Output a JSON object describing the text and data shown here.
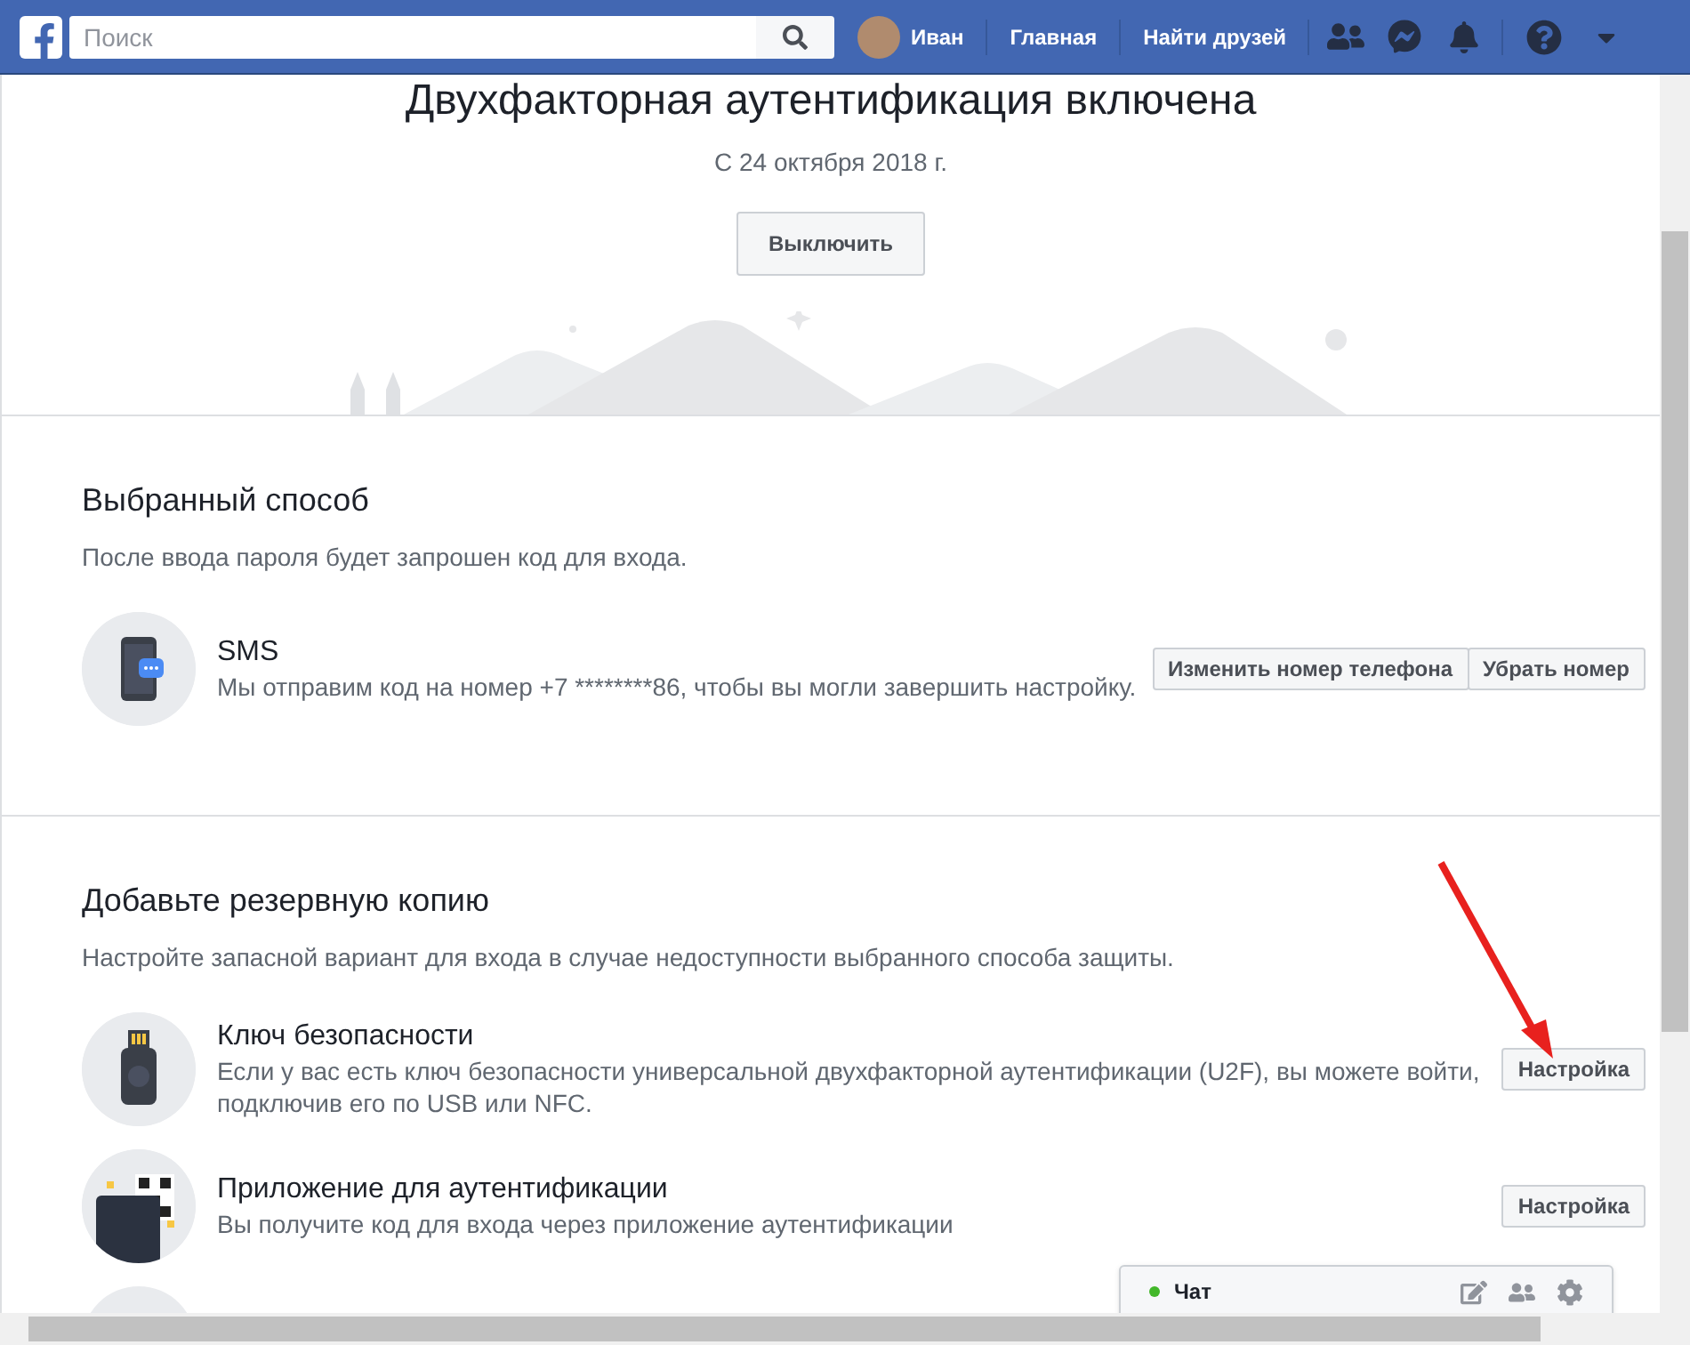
{
  "topbar": {
    "search": {
      "placeholder": "Поиск"
    },
    "user": "Иван",
    "links": [
      "Главная",
      "Найти друзей"
    ]
  },
  "hero": {
    "title": "Двухфакторная аутентификация включена",
    "date": "С 24 октября 2018 г.",
    "button": "Выключить"
  },
  "sections": [
    {
      "heading": "Выбранный способ",
      "description": "После ввода пароля будет запрошен код для входа.",
      "methods": [
        {
          "kind": "phone",
          "title": "SMS",
          "description": "Мы отправим код на номер +7 ********86, чтобы вы могли завершить настройку.",
          "buttons": [
            "Изменить номер телефона",
            "Убрать номер"
          ]
        }
      ]
    },
    {
      "heading": "Добавьте резервную копию",
      "description": "Настройте запасной вариант для входа в случае недоступности выбранного способа защиты.",
      "methods": [
        {
          "kind": "usb",
          "title": "Ключ безопасности",
          "description": "Если у вас есть ключ безопасности универсальной двухфакторной аутентификации (U2F), вы можете войти, подключив его по USB или NFC.",
          "buttons": [
            "Настройка"
          ]
        },
        {
          "kind": "qr",
          "title": "Приложение для аутентификации",
          "description": "Вы получите код для входа через приложение аутентификации",
          "buttons": [
            "Настройка"
          ]
        }
      ]
    }
  ],
  "chat": {
    "label": "Чат",
    "online": true
  }
}
